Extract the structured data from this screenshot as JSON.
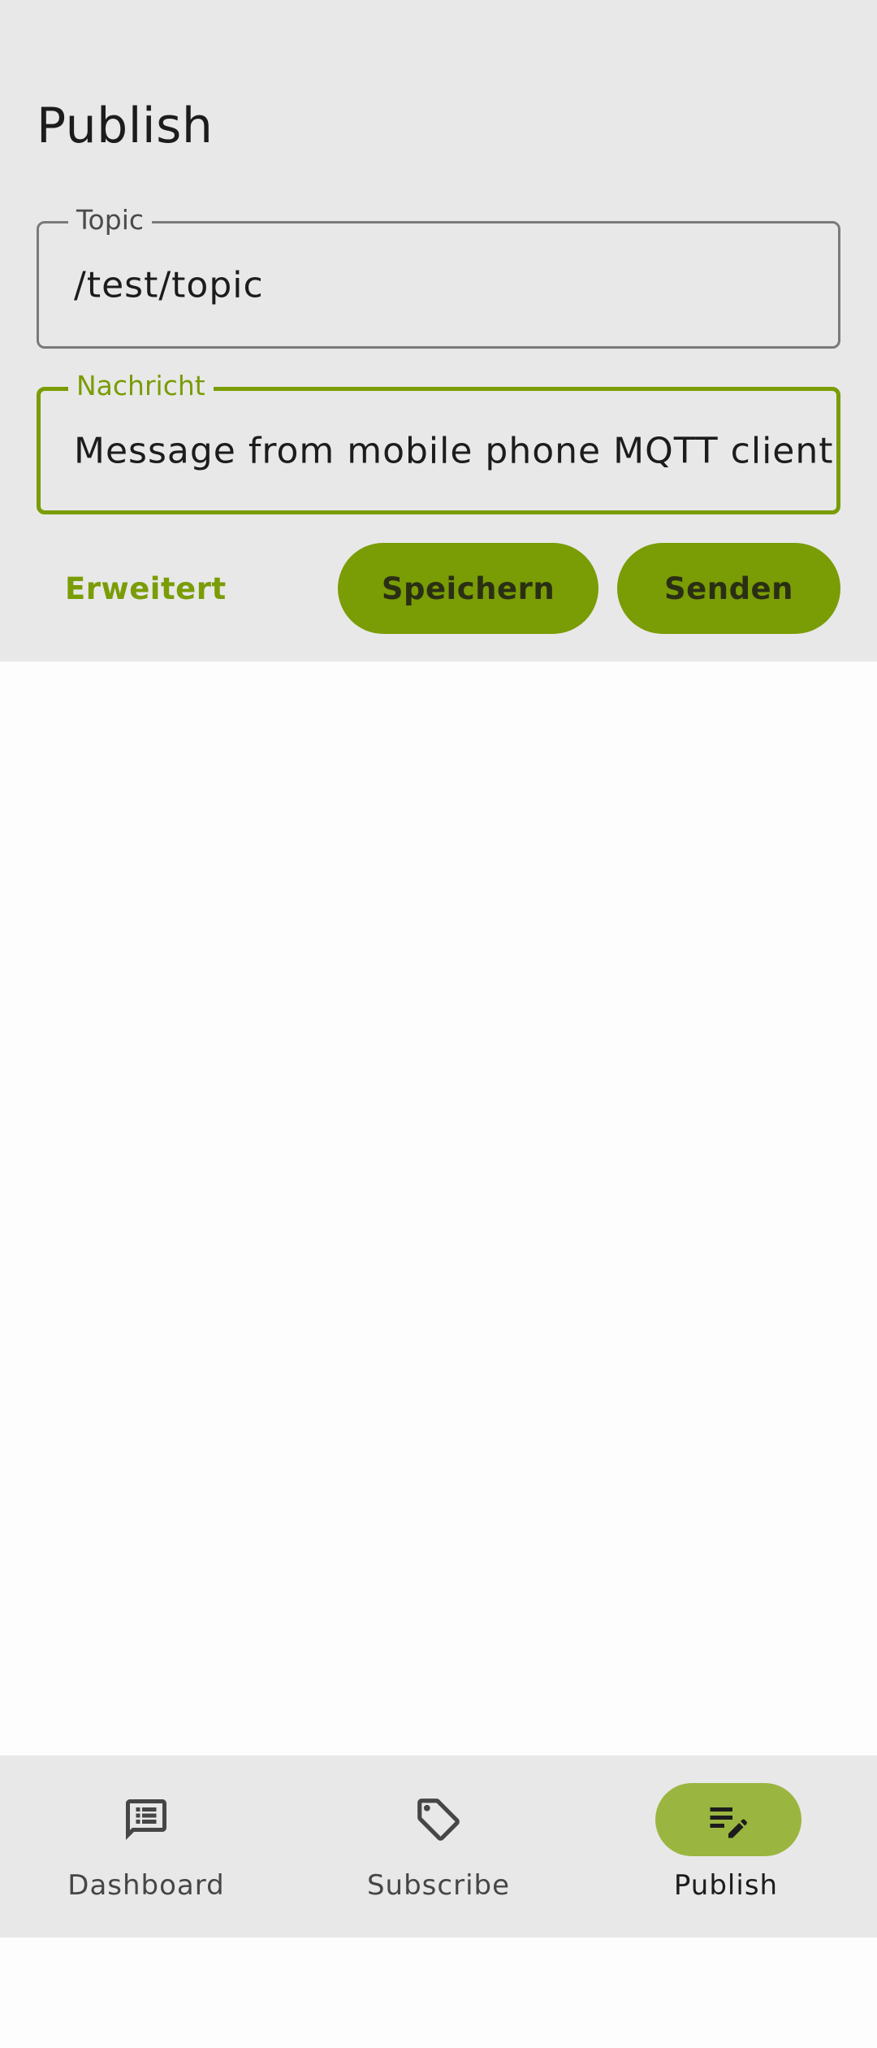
{
  "header": {
    "title": "Publish"
  },
  "form": {
    "topic": {
      "label": "Topic",
      "value": "/test/topic"
    },
    "message": {
      "label": "Nachricht",
      "value": "Message from mobile phone MQTT client"
    }
  },
  "actions": {
    "advanced_label": "Erweitert",
    "save_label": "Speichern",
    "send_label": "Senden"
  },
  "bottom_nav": {
    "items": [
      {
        "label": "Dashboard",
        "icon": "dashboard-list-icon",
        "selected": false
      },
      {
        "label": "Subscribe",
        "icon": "tag-icon",
        "selected": false
      },
      {
        "label": "Publish",
        "icon": "edit-note-icon",
        "selected": true
      }
    ]
  },
  "colors": {
    "accent": "#7a9c05",
    "selected_pill": "#9ab640",
    "panel_background": "#e8e8e8"
  }
}
